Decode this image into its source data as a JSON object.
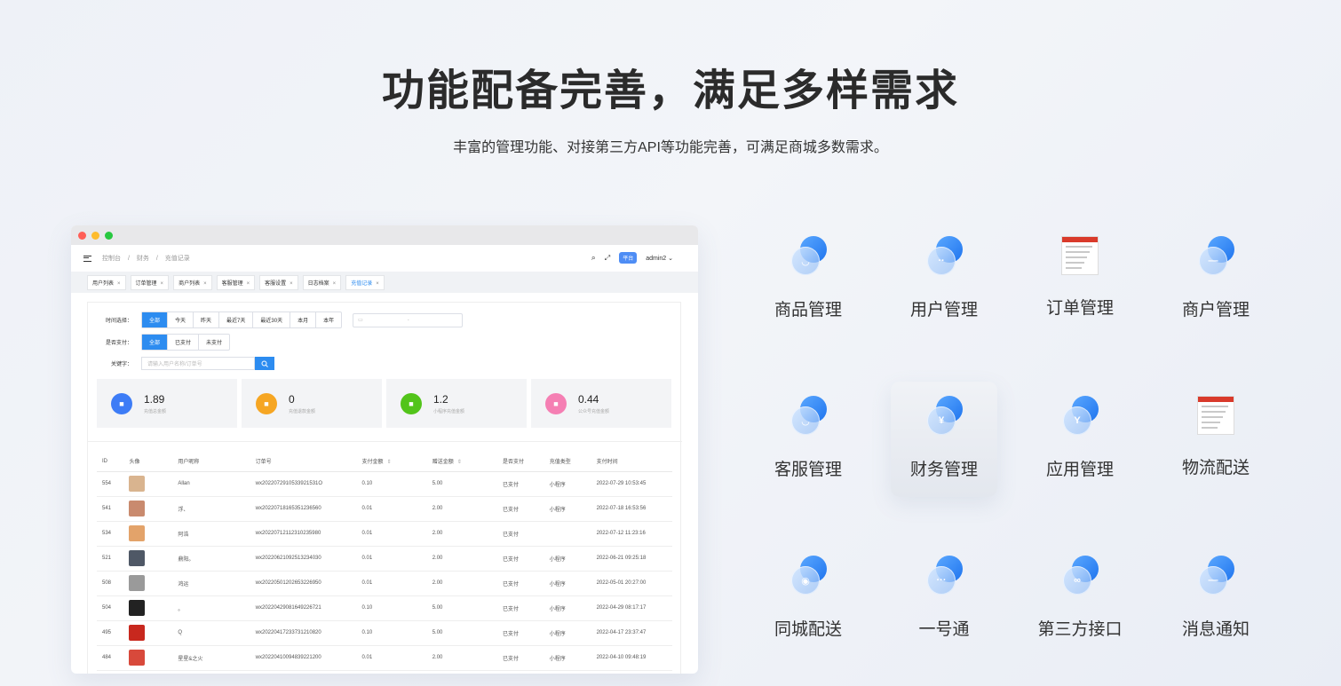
{
  "hero": {
    "title": "功能配备完善，满足多样需求",
    "subtitle": "丰富的管理功能、对接第三方API等功能完善，可满足商城多数需求。"
  },
  "admin": {
    "breadcrumb": [
      "控制台",
      "/",
      "财务",
      "/",
      "充值记录"
    ],
    "platform_badge": "平台",
    "username": "admin2",
    "tabs": [
      "用户列表",
      "订单管理",
      "商户列表",
      "客服管理",
      "客服设置",
      "日志档案",
      "充值记录"
    ],
    "active_tab": "充值记录",
    "filters": {
      "time_label": "时间选择：",
      "time_options": [
        "全部",
        "今天",
        "昨天",
        "最近7天",
        "最近30天",
        "本月",
        "本年"
      ],
      "date_separator": "-",
      "pay_label": "是否支付：",
      "pay_options": [
        "全部",
        "已支付",
        "未支付"
      ],
      "keyword_label": "关键字：",
      "keyword_placeholder": "请输入用户名称/订单号"
    },
    "stats": [
      {
        "value": "1.89",
        "label": "充值总金额",
        "color": "#3d7cf6",
        "icon": "bag-icon"
      },
      {
        "value": "0",
        "label": "充值退款金额",
        "color": "#f6a623",
        "icon": "document-icon"
      },
      {
        "value": "1.2",
        "label": "小程序充值金额",
        "color": "#52c41a",
        "icon": "briefcase-icon"
      },
      {
        "value": "0.44",
        "label": "公众号充值金额",
        "color": "#f57fb3",
        "icon": "wallet-icon"
      }
    ],
    "table": {
      "headers": [
        "ID",
        "头像",
        "用户昵称",
        "订单号",
        "支付金额",
        "赠送金额",
        "是否支付",
        "充值类型",
        "支付时间"
      ],
      "rows": [
        {
          "id": "554",
          "avatar_color": "#d9b48f",
          "nick": "Allan",
          "order": "wx2022072910533921531O",
          "pay": "0.10",
          "gift": "5.00",
          "paid": "已支付",
          "type": "小程序",
          "time": "2022-07-29 10:53:45"
        },
        {
          "id": "541",
          "avatar_color": "#c98a6e",
          "nick": "浮、",
          "order": "wx20220718165351236560",
          "pay": "0.01",
          "gift": "2.00",
          "paid": "已支付",
          "type": "小程序",
          "time": "2022-07-18 16:53:56"
        },
        {
          "id": "534",
          "avatar_color": "#e3a36a",
          "nick": "阿浩",
          "order": "wx20220712112310235980",
          "pay": "0.01",
          "gift": "2.00",
          "paid": "已支付",
          "type": "",
          "time": "2022-07-12 11:23:16"
        },
        {
          "id": "521",
          "avatar_color": "#4f5866",
          "nick": "鼎阳。",
          "order": "wx20220621092513234030",
          "pay": "0.01",
          "gift": "2.00",
          "paid": "已支付",
          "type": "小程序",
          "time": "2022-06-21 09:25:18"
        },
        {
          "id": "508",
          "avatar_color": "#9a9a9a",
          "nick": "鸿运",
          "order": "wx20220501202653226950",
          "pay": "0.01",
          "gift": "2.00",
          "paid": "已支付",
          "type": "小程序",
          "time": "2022-05-01 20:27:00"
        },
        {
          "id": "504",
          "avatar_color": "#222222",
          "nick": "。",
          "order": "wx20220429081649226721",
          "pay": "0.10",
          "gift": "5.00",
          "paid": "已支付",
          "type": "小程序",
          "time": "2022-04-29 08:17:17"
        },
        {
          "id": "495",
          "avatar_color": "#c8281e",
          "nick": "Q",
          "order": "wx20220417233731210820",
          "pay": "0.10",
          "gift": "5.00",
          "paid": "已支付",
          "type": "小程序",
          "time": "2022-04-17 23:37:47"
        },
        {
          "id": "484",
          "avatar_color": "#d8493b",
          "nick": "星星&之火",
          "order": "wx20220410094839221200",
          "pay": "0.01",
          "gift": "2.00",
          "paid": "已支付",
          "type": "小程序",
          "time": "2022-04-10 09:48:19"
        }
      ]
    }
  },
  "features": [
    {
      "label": "商品管理",
      "icon": "goods-icon",
      "glyph": "◡",
      "style": "bubble"
    },
    {
      "label": "用户管理",
      "icon": "user-icon",
      "glyph": "··",
      "style": "bubble"
    },
    {
      "label": "订单管理",
      "icon": "order-thumbnail",
      "glyph": "",
      "style": "thumb"
    },
    {
      "label": "商户管理",
      "icon": "merchant-icon",
      "glyph": "—",
      "style": "bubble"
    },
    {
      "label": "客服管理",
      "icon": "service-icon",
      "glyph": "◡",
      "style": "bubble"
    },
    {
      "label": "财务管理",
      "icon": "finance-icon",
      "glyph": "¥",
      "style": "bubble"
    },
    {
      "label": "应用管理",
      "icon": "app-icon",
      "glyph": "Y",
      "style": "bubble"
    },
    {
      "label": "物流配送",
      "icon": "logistics-thumbnail",
      "glyph": "",
      "style": "thumb"
    },
    {
      "label": "同城配送",
      "icon": "local-delivery-icon",
      "glyph": "◉",
      "style": "bubble"
    },
    {
      "label": "一号通",
      "icon": "one-pass-icon",
      "glyph": "···",
      "style": "bubble"
    },
    {
      "label": "第三方接口",
      "icon": "link-icon",
      "glyph": "∞",
      "style": "bubble"
    },
    {
      "label": "消息通知",
      "icon": "message-icon",
      "glyph": "—",
      "style": "bubble"
    }
  ],
  "active_feature": "财务管理",
  "colors": {
    "accent": "#2d8cf0",
    "bubble_blue": "#1f74ee"
  }
}
